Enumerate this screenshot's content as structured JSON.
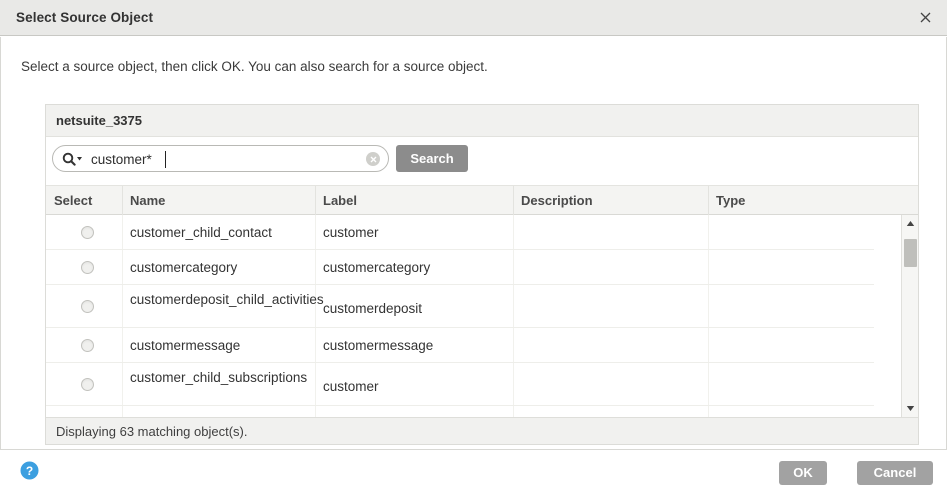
{
  "window": {
    "title": "Select Source Object",
    "close_icon": "close-icon"
  },
  "instruction": "Select a source object, then click OK. You can also search for a source object.",
  "panel": {
    "header_title": "netsuite_3375",
    "search": {
      "value": "customer*",
      "placeholder": "",
      "magnifier_icon": "search-dropdown-icon",
      "clear_icon": "clear-input-icon",
      "button_label": "Search"
    },
    "table": {
      "columns": [
        "Select",
        "Name",
        "Label",
        "Description",
        "Type"
      ],
      "rows": [
        {
          "name": "customer_child_contact",
          "label": "customer",
          "description": "",
          "type": ""
        },
        {
          "name": "customercategory",
          "label": "customercategory",
          "description": "",
          "type": ""
        },
        {
          "name": "customerdeposit_child_activities",
          "label": "customerdeposit",
          "description": "",
          "type": ""
        },
        {
          "name": "customermessage",
          "label": "customermessage",
          "description": "",
          "type": ""
        },
        {
          "name": "customer_child_subscriptions",
          "label": "customer",
          "description": "",
          "type": ""
        }
      ]
    },
    "status": "Displaying 63 matching object(s)."
  },
  "footer": {
    "help_icon": "help-icon",
    "ok_label": "OK",
    "cancel_label": "Cancel"
  },
  "colors": {
    "titlebar_bg": "#e9e9e7",
    "panel_header_bg": "#f1f1ef",
    "button_grey": "#a2a2a2",
    "search_button_grey": "#8c8c8c",
    "help_blue": "#3c9fe0"
  }
}
